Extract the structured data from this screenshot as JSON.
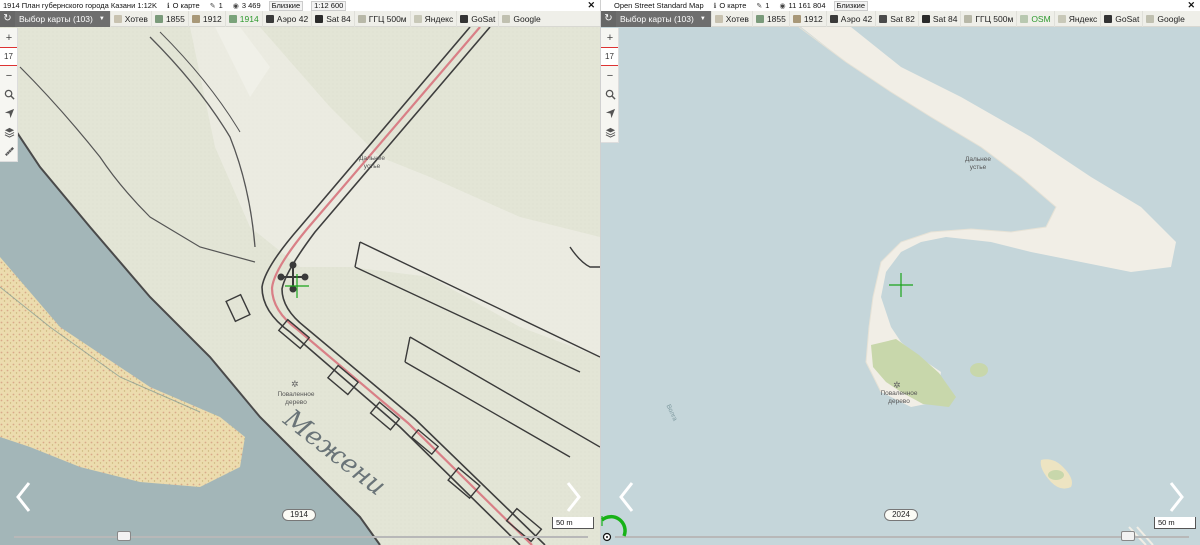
{
  "left_pane": {
    "title": "1914 План губернского города Казани 1:12K",
    "stats": {
      "on_map_label": "О карте",
      "edits": "1",
      "views": "3 469",
      "nearby_label": "Близкие",
      "scale": "1:12 600"
    },
    "toolbar": {
      "select_label": "Выбор карты (103)",
      "layers": [
        {
          "label": "Хотев",
          "icon_color": "#c8c2b0",
          "active": false
        },
        {
          "label": "1855",
          "icon_color": "#7a9a7a",
          "active": false
        },
        {
          "label": "1912",
          "icon_color": "#a89878",
          "active": false
        },
        {
          "label": "1914",
          "icon_color": "#7aa37a",
          "active": true
        },
        {
          "label": "Аэро 42",
          "icon_color": "#3a3a3a",
          "active": false
        },
        {
          "label": "Sat 84",
          "icon_color": "#2a2a2a",
          "active": false
        },
        {
          "label": "ГГЦ 500м",
          "icon_color": "#b8b8a8",
          "active": false
        },
        {
          "label": "Яндекс",
          "icon_color": "#c8c8b8",
          "active": false
        },
        {
          "label": "GoSat",
          "icon_color": "#333333",
          "active": false
        },
        {
          "label": "Google",
          "icon_color": "#c0c0b0",
          "active": false
        }
      ]
    },
    "zoom_level": "17",
    "labels": {
      "cape": "Дальнее\nустье",
      "tree": "Поваленное\nдерево",
      "handwritten": "Межени"
    },
    "year": "1914",
    "scale_bar": "50 m"
  },
  "right_pane": {
    "title": "Open Street Standard Map",
    "stats": {
      "on_map_label": "О карте",
      "edits": "1",
      "views": "11 161 804",
      "nearby_label": "Близкие"
    },
    "toolbar": {
      "select_label": "Выбор карты (103)",
      "layers": [
        {
          "label": "Хотев",
          "icon_color": "#c8c2b0",
          "active": false
        },
        {
          "label": "1855",
          "icon_color": "#7a9a7a",
          "active": false
        },
        {
          "label": "1912",
          "icon_color": "#a89878",
          "active": false
        },
        {
          "label": "Аэро 42",
          "icon_color": "#3a3a3a",
          "active": false
        },
        {
          "label": "Sat 82",
          "icon_color": "#4a4a4a",
          "active": false
        },
        {
          "label": "Sat 84",
          "icon_color": "#2a2a2a",
          "active": false
        },
        {
          "label": "ГГЦ 500м",
          "icon_color": "#b8b8a8",
          "active": false
        },
        {
          "label": "OSM",
          "icon_color": "#b8c8b0",
          "active": true
        },
        {
          "label": "Яндекс",
          "icon_color": "#c8c8b8",
          "active": false
        },
        {
          "label": "GoSat",
          "icon_color": "#333333",
          "active": false
        },
        {
          "label": "Google",
          "icon_color": "#c0c0b0",
          "active": false
        }
      ]
    },
    "zoom_level": "17",
    "labels": {
      "cape": "Дальнее\nустье",
      "tree": "Поваленное\nдерево",
      "river": "Волга"
    },
    "year": "2024",
    "scale_bar": "50 m"
  },
  "colors": {
    "osm_water": "#c5d6da",
    "osm_land": "#f1eee6",
    "osm_wood": "#c8d7ab",
    "old_paper": "#e6e6d8",
    "old_river": "#9fb3b6",
    "old_sand": "#e9d8a6",
    "active_layer": "#2f9a2f",
    "crosshair": "#1aa31a"
  }
}
